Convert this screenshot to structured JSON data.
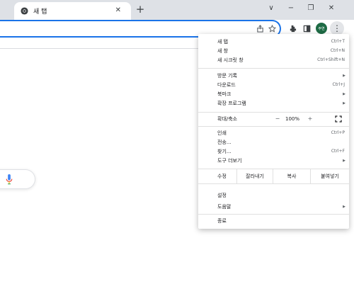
{
  "tab": {
    "title": "새 탭",
    "close": "✕"
  },
  "window": {
    "newtab": "+",
    "chevron": "∨",
    "minimize": "−",
    "restore": "❐",
    "close": "✕"
  },
  "toolbar": {
    "profile_initials": "주연",
    "kebab": "⋮"
  },
  "icons": [
    "share-icon",
    "star-icon",
    "extensions-icon",
    "sidepanel-icon",
    "mic-icon"
  ],
  "menu": {
    "group1": [
      {
        "label": "새 탭",
        "shortcut": "Ctrl+T"
      },
      {
        "label": "새 창",
        "shortcut": "Ctrl+N"
      },
      {
        "label": "새 시크릿 창",
        "shortcut": "Ctrl+Shift+N"
      }
    ],
    "group2": [
      {
        "label": "방문 기록",
        "arrow": "▶"
      },
      {
        "label": "다운로드",
        "shortcut": "Ctrl+J"
      },
      {
        "label": "북마크",
        "arrow": "▶"
      },
      {
        "label": "확장 프로그램",
        "arrow": "▶"
      }
    ],
    "zoom": {
      "label": "확대/축소",
      "minus": "−",
      "value": "100%",
      "plus": "+"
    },
    "group3": [
      {
        "label": "인쇄",
        "shortcut": "Ctrl+P"
      },
      {
        "label": "전송..."
      },
      {
        "label": "찾기...",
        "shortcut": "Ctrl+F"
      },
      {
        "label": "도구 더보기",
        "arrow": "▶"
      }
    ],
    "edit": {
      "label": "수정",
      "cut": "잘라내기",
      "copy": "복사",
      "paste": "붙여넣기"
    },
    "settings": {
      "label": "설정"
    },
    "help": {
      "label": "도움말",
      "arrow": "▶"
    },
    "exit": {
      "label": "종료"
    }
  },
  "colors": {
    "accent": "#1a73e8",
    "highlight_border": "#e0262a",
    "profile": "#1e6b45"
  }
}
